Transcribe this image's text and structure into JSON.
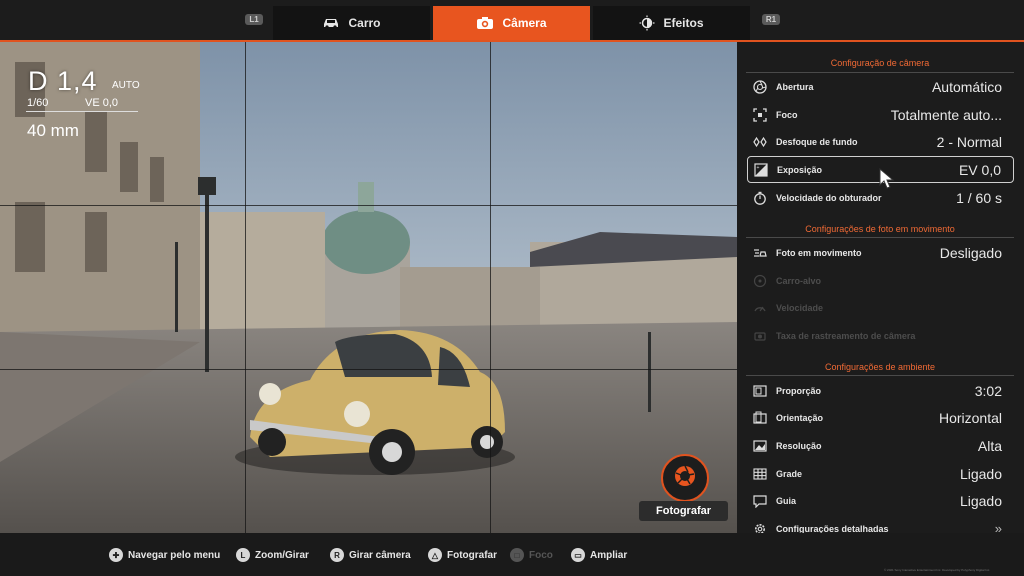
{
  "top_tabs": {
    "left_shoulder": "L1",
    "right_shoulder": "R1",
    "tabs": [
      {
        "label": "Carro",
        "icon": "car-icon",
        "active": false
      },
      {
        "label": "Câmera",
        "icon": "camera-icon",
        "active": true
      },
      {
        "label": "Efeitos",
        "icon": "effects-icon",
        "active": false
      }
    ]
  },
  "hud": {
    "aperture": "D 1,4",
    "aperture_mode": "AUTO",
    "shutter": "1/60",
    "ev": "VE 0,0",
    "focal_length": "40 mm"
  },
  "shutter_button": {
    "label": "Fotografar",
    "icon": "shutter-icon"
  },
  "panel": {
    "camera_section": {
      "title": "Configuração de câmera",
      "rows": [
        {
          "label": "Abertura",
          "value": "Automático",
          "icon": "aperture-icon"
        },
        {
          "label": "Foco",
          "value": "Totalmente auto...",
          "icon": "focus-icon"
        },
        {
          "label": "Desfoque de fundo",
          "value": "2 - Normal",
          "icon": "bokeh-icon"
        },
        {
          "label": "Exposição",
          "value": "EV 0,0",
          "icon": "exposure-icon"
        },
        {
          "label": "Velocidade do obturador",
          "value": "1 / 60 s",
          "icon": "stopwatch-icon"
        }
      ]
    },
    "motion_section": {
      "title": "Configurações de foto em movimento",
      "rows": [
        {
          "label": "Foto em movimento",
          "value": "Desligado",
          "icon": "motion-icon"
        },
        {
          "label": "Carro-alvo",
          "value": "",
          "icon": "target-icon"
        },
        {
          "label": "Velocidade",
          "value": "",
          "icon": "speed-icon"
        },
        {
          "label": "Taxa de rastreamento de câmera",
          "value": "",
          "icon": "tracking-icon"
        }
      ]
    },
    "ambient_section": {
      "title": "Configurações de ambiente",
      "rows": [
        {
          "label": "Proporção",
          "value": "3:02",
          "icon": "ratio-icon"
        },
        {
          "label": "Orientação",
          "value": "Horizontal",
          "icon": "orientation-icon"
        },
        {
          "label": "Resolução",
          "value": "Alta",
          "icon": "resolution-icon"
        },
        {
          "label": "Grade",
          "value": "Ligado",
          "icon": "grid-icon"
        },
        {
          "label": "Guia",
          "value": "Ligado",
          "icon": "guide-icon"
        },
        {
          "label": "Configurações detalhadas",
          "value": "»",
          "icon": "gear-icon"
        }
      ]
    }
  },
  "bottom_bar": [
    {
      "icon": "dpad-icon",
      "glyph": "✚",
      "label": "Navegar pelo menu",
      "enabled": true
    },
    {
      "icon": "l-stick-icon",
      "glyph": "L",
      "label": "Zoom/Girar",
      "enabled": true
    },
    {
      "icon": "r-stick-icon",
      "glyph": "R",
      "label": "Girar câmera",
      "enabled": true
    },
    {
      "icon": "triangle-button-icon",
      "glyph": "△",
      "label": "Fotografar",
      "enabled": true
    },
    {
      "icon": "square-button-icon",
      "glyph": "□",
      "label": "Foco",
      "enabled": false
    },
    {
      "icon": "touchpad-icon",
      "glyph": "▭",
      "label": "Ampliar",
      "enabled": true
    }
  ],
  "copyright": "© 2021 Sony Interactive Entertainment Inc. Developed by Polyphony Digital Inc.",
  "colors": {
    "accent": "#e8551f",
    "section_title": "#f06a35",
    "panel_bg": "#1c1c1c"
  }
}
